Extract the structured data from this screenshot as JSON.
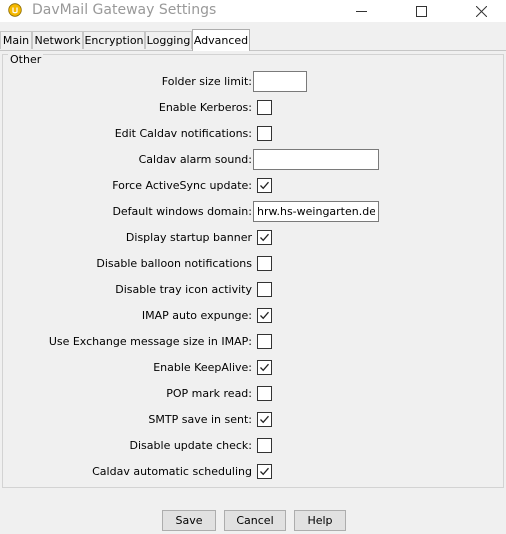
{
  "window": {
    "title": "DavMail Gateway Settings",
    "icon": "davmail-app-icon",
    "minimize_icon": "minimize-icon",
    "maximize_icon": "maximize-icon",
    "close_icon": "close-icon"
  },
  "tabs": [
    {
      "label": "Main",
      "active": false
    },
    {
      "label": "Network",
      "active": false
    },
    {
      "label": "Encryption",
      "active": false
    },
    {
      "label": "Logging",
      "active": false
    },
    {
      "label": "Advanced",
      "active": true
    }
  ],
  "panel": {
    "legend": "Other",
    "settings": [
      {
        "label": "Folder size limit:",
        "type": "text",
        "value": ""
      },
      {
        "label": "Enable Kerberos:",
        "type": "checkbox",
        "checked": false
      },
      {
        "label": "Edit Caldav notifications:",
        "type": "checkbox",
        "checked": false
      },
      {
        "label": "Caldav alarm sound:",
        "type": "text",
        "value": ""
      },
      {
        "label": "Force ActiveSync update:",
        "type": "checkbox",
        "checked": true
      },
      {
        "label": "Default windows domain:",
        "type": "text",
        "value": "hrw.hs-weingarten.de"
      },
      {
        "label": "Display startup banner",
        "type": "checkbox",
        "checked": true
      },
      {
        "label": "Disable balloon notifications",
        "type": "checkbox",
        "checked": false
      },
      {
        "label": "Disable tray icon activity",
        "type": "checkbox",
        "checked": false
      },
      {
        "label": "IMAP auto expunge:",
        "type": "checkbox",
        "checked": true
      },
      {
        "label": "Use Exchange message size in IMAP:",
        "type": "checkbox",
        "checked": false
      },
      {
        "label": "Enable KeepAlive:",
        "type": "checkbox",
        "checked": true
      },
      {
        "label": "POP mark read:",
        "type": "checkbox",
        "checked": false
      },
      {
        "label": "SMTP save in sent:",
        "type": "checkbox",
        "checked": true
      },
      {
        "label": "Disable update check:",
        "type": "checkbox",
        "checked": false
      },
      {
        "label": "Caldav automatic scheduling",
        "type": "checkbox",
        "checked": true
      }
    ]
  },
  "buttons": {
    "save": "Save",
    "cancel": "Cancel",
    "help": "Help"
  },
  "colors": {
    "window_bg": "#f0f0f0",
    "titlebar_bg": "#ffffff",
    "title_text": "#999999",
    "app_icon": "#f5b800"
  }
}
